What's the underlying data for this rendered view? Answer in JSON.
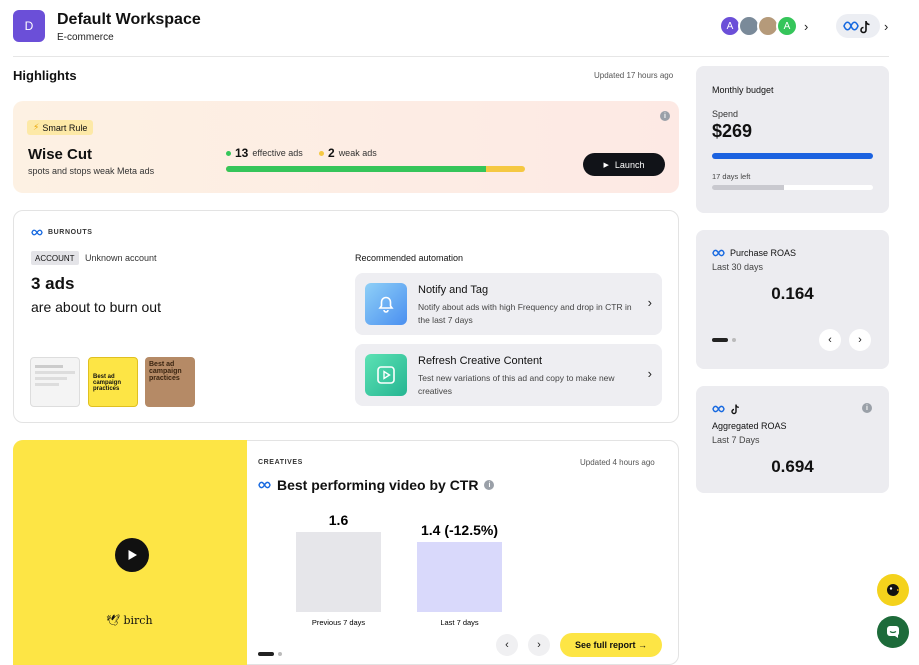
{
  "workspace": {
    "initial": "D",
    "name": "Default Workspace",
    "type": "E-commerce"
  },
  "header": {
    "avatars": [
      {
        "initial": "A",
        "color": "#6b4fd8"
      },
      {
        "initial": "",
        "color": "#7a8a99"
      },
      {
        "initial": "",
        "color": "#b59a7a"
      },
      {
        "initial": "A",
        "color": "#35c55a"
      }
    ]
  },
  "highlights": {
    "title": "Highlights",
    "updated": "Updated 17 hours ago",
    "smart_rule": {
      "pill": "Smart Rule",
      "name": "Wise Cut",
      "desc": "spots and stops weak Meta ads",
      "effective_count": "13",
      "effective_label": "effective ads",
      "weak_count": "2",
      "weak_label": "weak ads",
      "effective_fraction": 0.87,
      "launch_label": "Launch",
      "colors": {
        "effective": "#35c55a",
        "weak": "#f5c842"
      }
    }
  },
  "burnouts": {
    "label": "BURNOUTS",
    "account_badge": "ACCOUNT",
    "account_name": "Unknown account",
    "ads_count": "3 ads",
    "ads_sub": "are about to burn out",
    "recommended_title": "Recommended automation",
    "thumbs": [
      {
        "text": ""
      },
      {
        "text": "Best ad campaign practices"
      },
      {
        "text": "Best ad campaign practices"
      }
    ],
    "automations": [
      {
        "title": "Notify and Tag",
        "desc": "Notify about ads with high Frequency and drop in CTR in the last 7 days",
        "icon": "bell-icon"
      },
      {
        "title": "Refresh Creative Content",
        "desc": "Test new variations of this ad and copy to make new creatives",
        "icon": "play-square-icon"
      }
    ]
  },
  "creatives": {
    "label": "CREATIVES",
    "updated": "Updated 4 hours ago",
    "title": "Best performing video by CTR",
    "brand": "birch",
    "see_full": "See full report →"
  },
  "chart_data": {
    "type": "bar",
    "categories": [
      "Previous 7 days",
      "Last 7 days"
    ],
    "values": [
      1.6,
      1.4
    ],
    "value_labels": [
      "1.6",
      "1.4 (-12.5%)"
    ],
    "ylim": [
      0,
      1.6
    ],
    "colors": [
      "#e6e6ea",
      "#d9d9fb"
    ]
  },
  "right": {
    "budget": {
      "title": "Monthly budget",
      "spend_label": "Spend",
      "spend": "$269",
      "spend_fraction": 1.0,
      "days_left": "17 days left",
      "days_fraction": 0.45
    },
    "purchase_roas": {
      "title": "Purchase ROAS",
      "period": "Last 30 days",
      "value": "0.164"
    },
    "aggregated_roas": {
      "title": "Aggregated ROAS",
      "period": "Last 7 Days",
      "value": "0.694"
    }
  }
}
